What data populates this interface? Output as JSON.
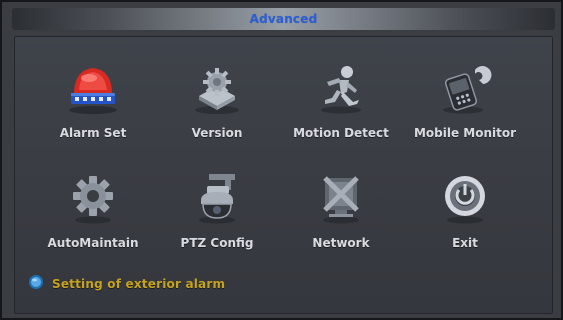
{
  "window": {
    "title": "Advanced"
  },
  "menu": {
    "items": [
      {
        "label": "Alarm Set",
        "icon": "alarm-siren-icon"
      },
      {
        "label": "Version",
        "icon": "version-gear-icon"
      },
      {
        "label": "Motion Detect",
        "icon": "running-person-icon"
      },
      {
        "label": "Mobile Monitor",
        "icon": "mobile-phone-icon"
      },
      {
        "label": "AutoMaintain",
        "icon": "maintain-gear-icon"
      },
      {
        "label": "PTZ Config",
        "icon": "ptz-camera-icon"
      },
      {
        "label": "Network",
        "icon": "network-icon"
      },
      {
        "label": "Exit",
        "icon": "power-exit-icon"
      }
    ]
  },
  "status": {
    "icon": "info-indicator-icon",
    "text": "Setting of exterior alarm"
  },
  "colors": {
    "title_text": "#2a5fd8",
    "status_text": "#c5a21f",
    "label_text": "#d8dbe0",
    "panel_bg": "#3a3d42"
  }
}
